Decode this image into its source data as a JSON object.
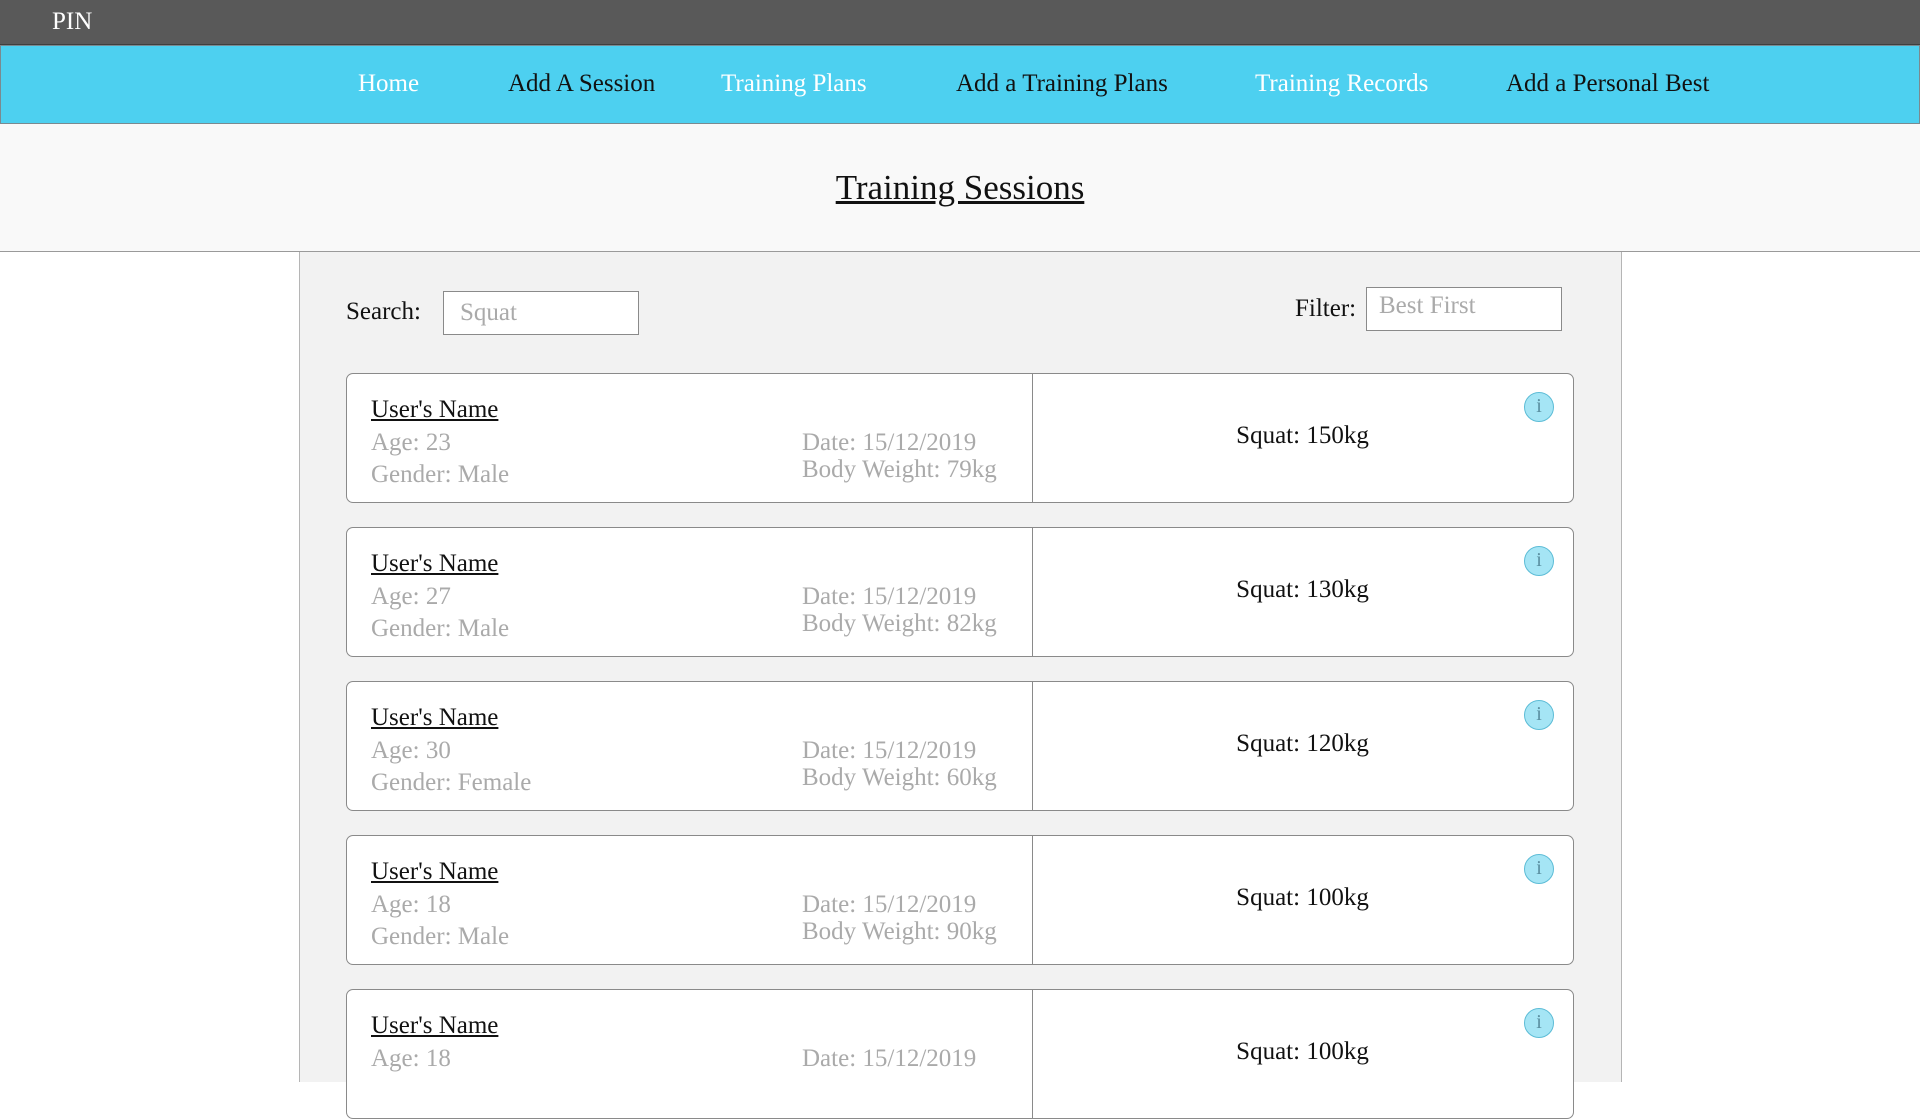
{
  "app": {
    "brand": "PIN"
  },
  "nav": [
    {
      "label": "Home"
    },
    {
      "label": "Add A Session"
    },
    {
      "label": "Training Plans"
    },
    {
      "label": "Add a Training Plans"
    },
    {
      "label": "Training Records"
    },
    {
      "label": "Add a Personal Best"
    }
  ],
  "page": {
    "title": "Training Sessions"
  },
  "search": {
    "label": "Search:",
    "placeholder": "Squat"
  },
  "filter": {
    "label": "Filter:",
    "value": "Best First"
  },
  "colors": {
    "topbar": "#595959",
    "navbar": "#4dd0f0",
    "panel": "#f2f2f2",
    "info_icon": "#a5e5f5"
  },
  "sessions": [
    {
      "name": "User's Name",
      "age": "Age: 23",
      "gender": "Gender: Male",
      "date": "Date: 15/12/2019",
      "body_weight": "Body Weight: 79kg",
      "lift": "Squat: 150kg",
      "info": "i"
    },
    {
      "name": "User's Name",
      "age": "Age: 27",
      "gender": "Gender: Male",
      "date": "Date: 15/12/2019",
      "body_weight": "Body Weight: 82kg",
      "lift": "Squat: 130kg",
      "info": "i"
    },
    {
      "name": "User's Name",
      "age": "Age: 30",
      "gender": "Gender: Female",
      "date": "Date: 15/12/2019",
      "body_weight": "Body Weight: 60kg",
      "lift": "Squat: 120kg",
      "info": "i"
    },
    {
      "name": "User's Name",
      "age": "Age: 18",
      "gender": "Gender: Male",
      "date": "Date: 15/12/2019",
      "body_weight": "Body Weight: 90kg",
      "lift": "Squat: 100kg",
      "info": "i"
    },
    {
      "name": "User's Name",
      "age": "Age: 18",
      "gender": "",
      "date": "Date: 15/12/2019",
      "body_weight": "",
      "lift": "Squat: 100kg",
      "info": "i"
    }
  ]
}
